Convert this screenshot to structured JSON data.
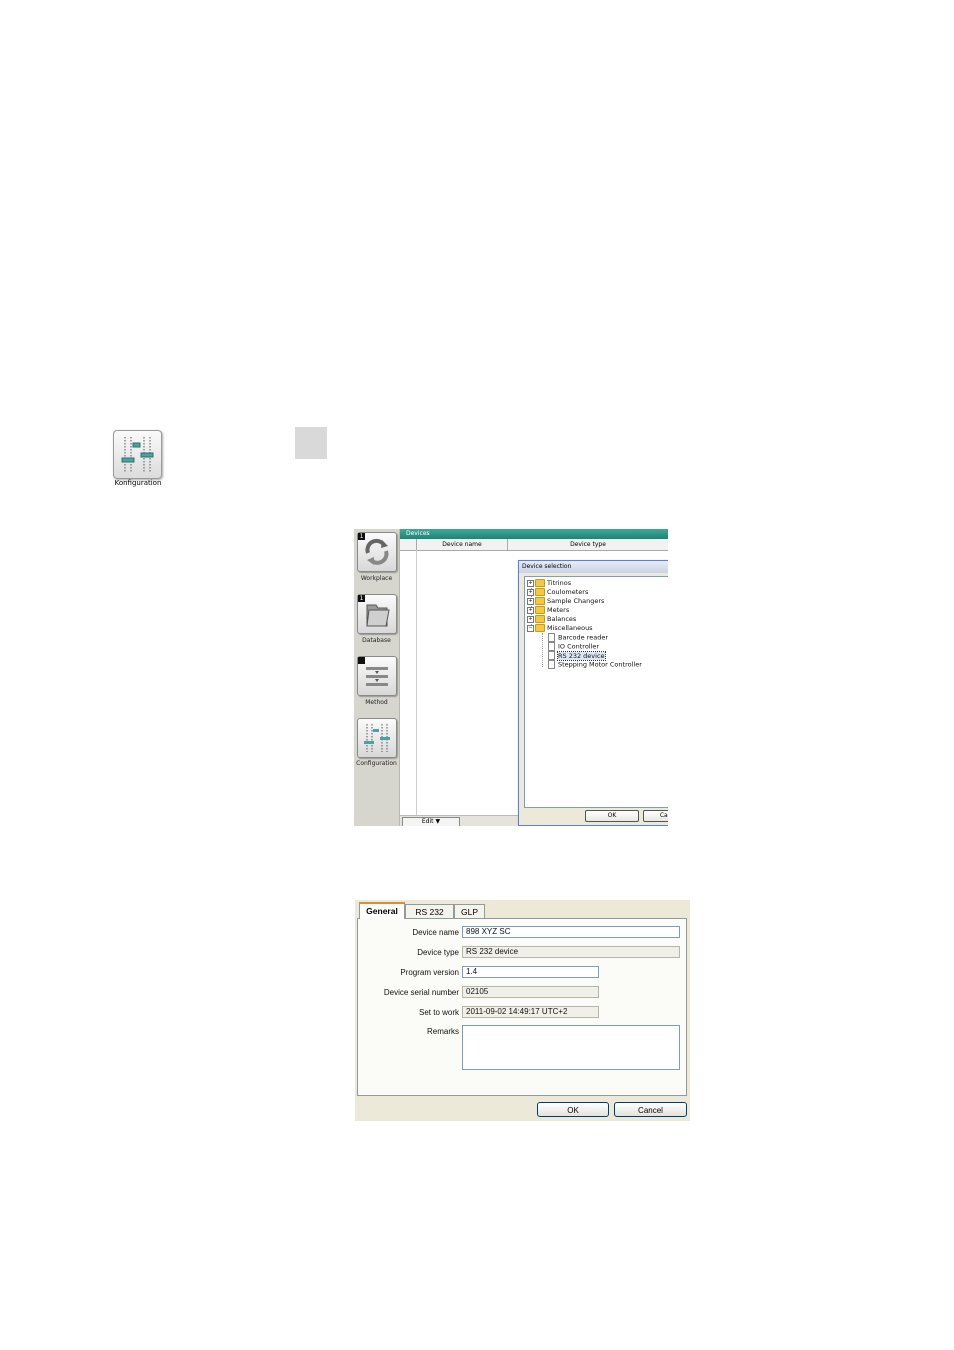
{
  "konfiguration": {
    "label": "Konfiguration",
    "icon": "sliders-icon"
  },
  "sidebar": {
    "items": [
      {
        "label": "Workplace",
        "badge": "1",
        "icon": "workplace-recycle-icon"
      },
      {
        "label": "Database",
        "badge": "1",
        "icon": "folder-icon"
      },
      {
        "label": "Method",
        "badge": "",
        "icon": "method-list-icon"
      },
      {
        "label": "Configuration",
        "badge": "",
        "icon": "sliders-icon"
      }
    ]
  },
  "devices": {
    "title": "Devices",
    "columns": [
      "Device name",
      "Device type"
    ],
    "edit_label": "Edit"
  },
  "device_selection": {
    "title": "Device selection",
    "close": "✕",
    "tree": [
      {
        "label": "Titrinos",
        "type": "folder"
      },
      {
        "label": "Coulometers",
        "type": "folder"
      },
      {
        "label": "Sample Changers",
        "type": "folder"
      },
      {
        "label": "Meters",
        "type": "folder"
      },
      {
        "label": "Balances",
        "type": "folder"
      },
      {
        "label": "Miscellaneous",
        "type": "folder",
        "expanded": true,
        "children": [
          {
            "label": "Barcode reader"
          },
          {
            "label": "IO Controller"
          },
          {
            "label": "RS 232 device",
            "selected": true
          },
          {
            "label": "Stepping Motor Controller"
          }
        ]
      }
    ],
    "ok": "OK",
    "cancel": "Cancel"
  },
  "properties": {
    "tabs": [
      "General",
      "RS 232",
      "GLP"
    ],
    "fields": {
      "device_name": {
        "label": "Device name",
        "value": "898 XYZ SC"
      },
      "device_type": {
        "label": "Device type",
        "value": "RS 232 device"
      },
      "program_version": {
        "label": "Program version",
        "value": "1.4"
      },
      "serial_number": {
        "label": "Device serial number",
        "value": "02105"
      },
      "set_to_work": {
        "label": "Set to work",
        "value": "2011-09-02 14:49:17 UTC+2"
      },
      "remarks": {
        "label": "Remarks",
        "value": ""
      }
    },
    "ok": "OK",
    "cancel": "Cancel"
  }
}
